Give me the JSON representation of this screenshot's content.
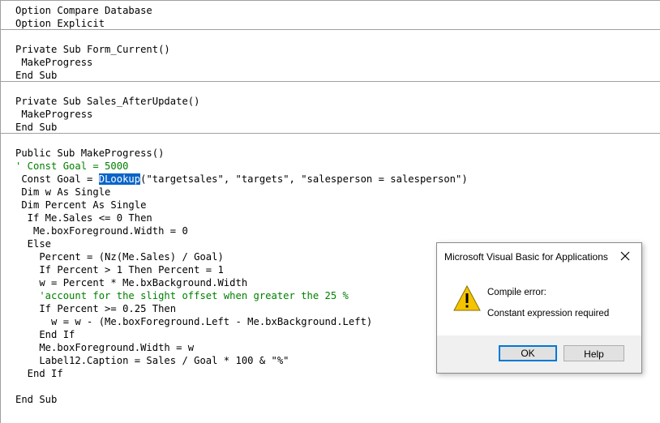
{
  "editor": {
    "lines": [
      "Option Compare Database",
      "Option Explicit",
      "Private Sub Form_Current()",
      " MakeProgress",
      "End Sub",
      "Private Sub Sales_AfterUpdate()",
      " MakeProgress",
      "End Sub",
      "Public Sub MakeProgress()",
      "' Const Goal = 5000",
      " Const Goal = ",
      "DLookup",
      "(\"targetsales\", \"targets\", \"salesperson = salesperson\")",
      " Dim w As Single",
      " Dim Percent As Single",
      "  If Me.Sales <= 0 Then",
      "   Me.boxForeground.Width = 0",
      "  Else",
      "    Percent = (Nz(Me.Sales) / Goal)",
      "    If Percent > 1 Then Percent = 1",
      "    w = Percent * Me.bxBackground.Width",
      "    'account for the slight offset when greater the 25 %",
      "    If Percent >= 0.25 Then",
      "      w = w - (Me.boxForeground.Left - Me.bxBackground.Left)",
      "    End If",
      "    Me.boxForeground.Width = w",
      "    Label12.Caption = Sales / Goal * 100 & \"%\"",
      "  End If",
      "End Sub"
    ]
  },
  "dialog": {
    "title": "Microsoft Visual Basic for Applications",
    "message_title": "Compile error:",
    "message": "Constant expression required",
    "ok_label": "OK",
    "help_label": "Help",
    "icon": "warning-icon"
  },
  "colors": {
    "keyword": "#00008b",
    "comment": "#008000",
    "selection": "#0a64c8",
    "ok_border": "#0078d7"
  }
}
